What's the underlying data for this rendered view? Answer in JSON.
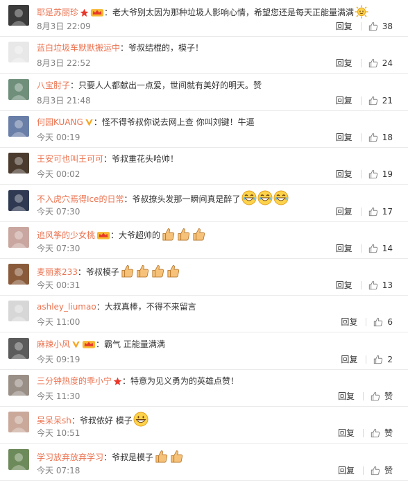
{
  "comments": [
    {
      "user": "耶是苏丽珍",
      "badges": [
        "star",
        "vip"
      ],
      "text": "老大爷别太因为那种垃圾人影响心情，希望您还是每天正能量满满",
      "emoji": [
        "sun"
      ],
      "time": "8月3日 22:09",
      "reply": "回复",
      "likes": "38",
      "avatar_color": "#3b3b3b"
    },
    {
      "user": "蓝白垃圾车默默搬运中",
      "badges": [],
      "text": "爷叔结棍的，模子！",
      "emoji": [],
      "time": "8月3日 22:52",
      "reply": "回复",
      "likes": "24",
      "avatar_color": "#e8e8e8"
    },
    {
      "user": "八宝肘子",
      "badges": [],
      "text": "只要人人都献出一点爱，世间就有美好的明天。赞",
      "emoji": [],
      "time": "8月3日 21:48",
      "reply": "回复",
      "likes": "21",
      "avatar_color": "#6f8f7a"
    },
    {
      "user": "何园KUANG",
      "badges": [
        "v"
      ],
      "text": "怪不得爷叔你说去网上查 你叫刘键！牛逼",
      "emoji": [],
      "time": "今天 00:19",
      "reply": "回复",
      "likes": "18",
      "avatar_color": "#6a7fa8"
    },
    {
      "user": "王安可也叫王可可",
      "badges": [],
      "text": "爷叔重花头哈帅！",
      "emoji": [],
      "time": "今天 00:02",
      "reply": "回复",
      "likes": "19",
      "avatar_color": "#4a3b2e"
    },
    {
      "user": "不入虎穴焉得Ice的日常",
      "badges": [],
      "text": "爷叔撩头发那一瞬间真是醉了",
      "emoji": [
        "laugh",
        "laugh",
        "laugh"
      ],
      "time": "今天 07:30",
      "reply": "回复",
      "likes": "17",
      "avatar_color": "#2f3a52"
    },
    {
      "user": "追风筝的少女桃",
      "badges": [
        "vip"
      ],
      "text": "大爷超帅的",
      "emoji": [
        "thumb",
        "thumb",
        "thumb"
      ],
      "time": "今天 07:30",
      "reply": "回复",
      "likes": "14",
      "avatar_color": "#c9a7a0"
    },
    {
      "user": "麦丽素233",
      "badges": [],
      "text": "爷叔模子",
      "emoji": [
        "thumb",
        "thumb",
        "thumb",
        "thumb"
      ],
      "time": "今天 00:31",
      "reply": "回复",
      "likes": "13",
      "avatar_color": "#8a5b3b"
    },
    {
      "user": "ashley_liumao",
      "badges": [],
      "text": "大叔真棒，不得不来留言",
      "emoji": [],
      "time": "今天 11:00",
      "reply": "回复",
      "likes": "6",
      "avatar_color": "#d7d7d7"
    },
    {
      "user": "麻辣小风",
      "badges": [
        "v",
        "vip"
      ],
      "text": "霸气 正能量满满",
      "emoji": [],
      "time": "今天 09:19",
      "reply": "回复",
      "likes": "2",
      "avatar_color": "#5b5b5b"
    },
    {
      "user": "三分钟热度的乖小宁",
      "badges": [
        "star"
      ],
      "text": "特意为见义勇为的英雄点赞！",
      "emoji": [],
      "time": "今天 11:30",
      "reply": "回复",
      "likes": "赞",
      "avatar_color": "#9a8f86"
    },
    {
      "user": "吴呆呆sh",
      "badges": [],
      "text": "爷叔侬好 模子",
      "emoji": [
        "grin"
      ],
      "time": "今天 10:51",
      "reply": "回复",
      "likes": "赞",
      "avatar_color": "#caa99a"
    },
    {
      "user": "学习放弃放弃学习",
      "badges": [],
      "text": "爷叔是模子",
      "emoji": [
        "thumb",
        "thumb"
      ],
      "time": "今天 07:18",
      "reply": "回复",
      "likes": "赞",
      "avatar_color": "#6d8a5a"
    }
  ],
  "colors": {
    "username": "#eb7350",
    "text": "#333333",
    "time": "#808080"
  }
}
